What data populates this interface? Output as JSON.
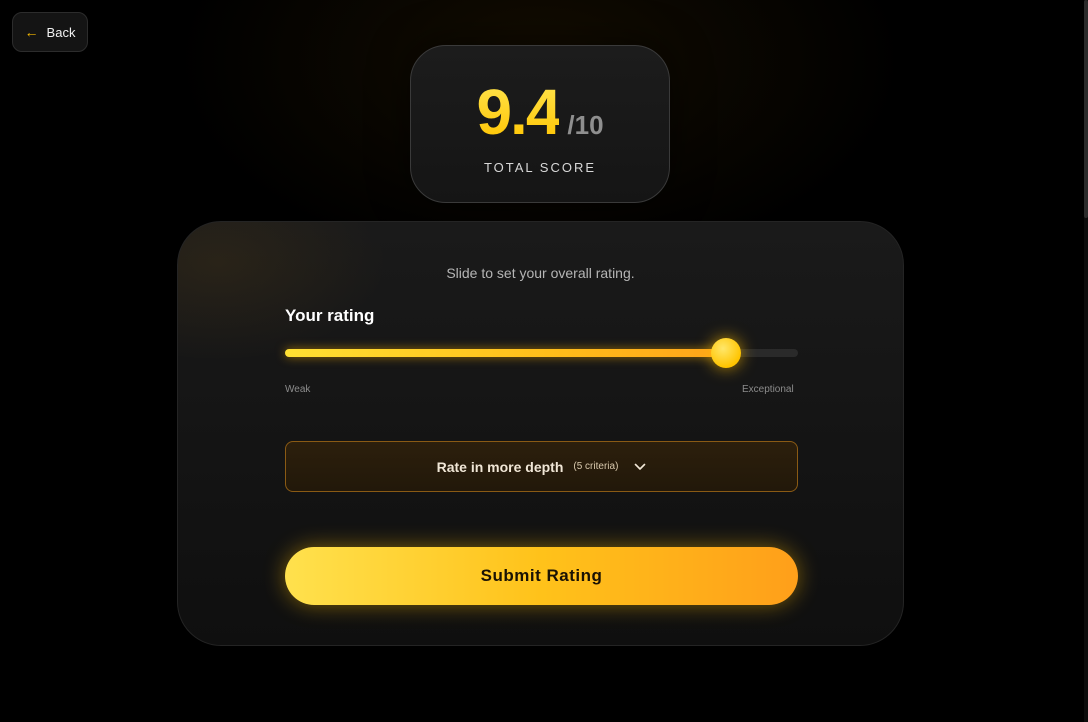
{
  "back_button": {
    "label": "Back",
    "icon": "arrow-left-icon"
  },
  "score": {
    "value": "9.4",
    "max": "/10",
    "label": "TOTAL SCORE"
  },
  "rating_card": {
    "instruction": "Slide to set your overall rating.",
    "title": "Your rating",
    "slider": {
      "value": 9.4,
      "min": 0,
      "max": 10,
      "min_label": "Weak",
      "max_label": "Exceptional"
    },
    "depth_button": {
      "label": "Rate in more depth",
      "count": "(5 criteria)",
      "icon": "chevron-down-icon"
    },
    "submit_label": "Submit Rating"
  },
  "colors": {
    "accent": "#ffc400",
    "accent_orange": "#ff9f1a",
    "background": "#000000",
    "card": "#151515"
  }
}
